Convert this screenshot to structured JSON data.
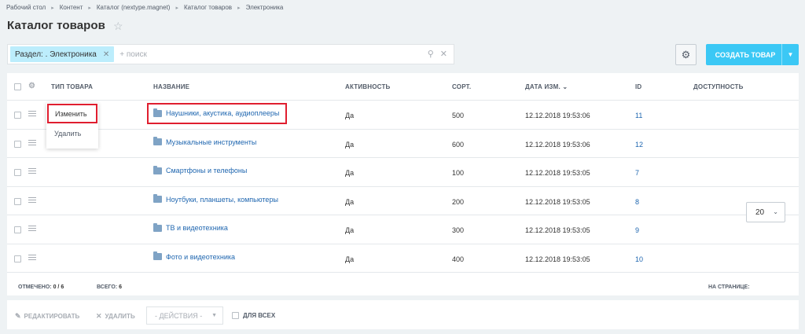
{
  "breadcrumbs": [
    "Рабочий стол",
    "Контент",
    "Каталог (nextype.magnet)",
    "Каталог товаров",
    "Электроника"
  ],
  "page_title": "Каталог товаров",
  "filter": {
    "tag_label": "Раздел: . Электроника",
    "placeholder": "+ поиск"
  },
  "toolbar": {
    "create_label": "СОЗДАТЬ ТОВАР"
  },
  "columns": {
    "type": "ТИП ТОВАРА",
    "name": "НАЗВАНИЕ",
    "active": "АКТИВНОСТЬ",
    "sort": "СОРТ.",
    "date": "ДАТА ИЗМ.",
    "id": "ID",
    "availability": "ДОСТУПНОСТЬ"
  },
  "rows": [
    {
      "name": "Наушники, акустика, аудиоплееры",
      "active": "Да",
      "sort": "500",
      "date": "12.12.2018 19:53:06",
      "id": "11"
    },
    {
      "name": "Музыкальные инструменты",
      "active": "Да",
      "sort": "600",
      "date": "12.12.2018 19:53:06",
      "id": "12"
    },
    {
      "name": "Смартфоны и телефоны",
      "active": "Да",
      "sort": "100",
      "date": "12.12.2018 19:53:05",
      "id": "7"
    },
    {
      "name": "Ноутбуки, планшеты, компьютеры",
      "active": "Да",
      "sort": "200",
      "date": "12.12.2018 19:53:05",
      "id": "8"
    },
    {
      "name": "ТВ и видеотехника",
      "active": "Да",
      "sort": "300",
      "date": "12.12.2018 19:53:05",
      "id": "9"
    },
    {
      "name": "Фото и видеотехника",
      "active": "Да",
      "sort": "400",
      "date": "12.12.2018 19:53:05",
      "id": "10"
    }
  ],
  "context_menu": {
    "edit": "Изменить",
    "delete": "Удалить"
  },
  "footer": {
    "selected_label": "ОТМЕЧЕНО:",
    "selected_value": "0 / 6",
    "total_label": "ВСЕГО:",
    "total_value": "6",
    "per_page_label": "НА СТРАНИЦЕ:",
    "per_page_value": "20"
  },
  "action_bar": {
    "edit": "РЕДАКТИРОВАТЬ",
    "delete": "УДАЛИТЬ",
    "actions": "- ДЕЙСТВИЯ -",
    "for_all": "ДЛЯ ВСЕХ"
  },
  "colors": {
    "accent": "#3bc8f5",
    "link": "#2067b0",
    "highlight": "#e01e2f",
    "filter_tag": "#bcedfc"
  }
}
